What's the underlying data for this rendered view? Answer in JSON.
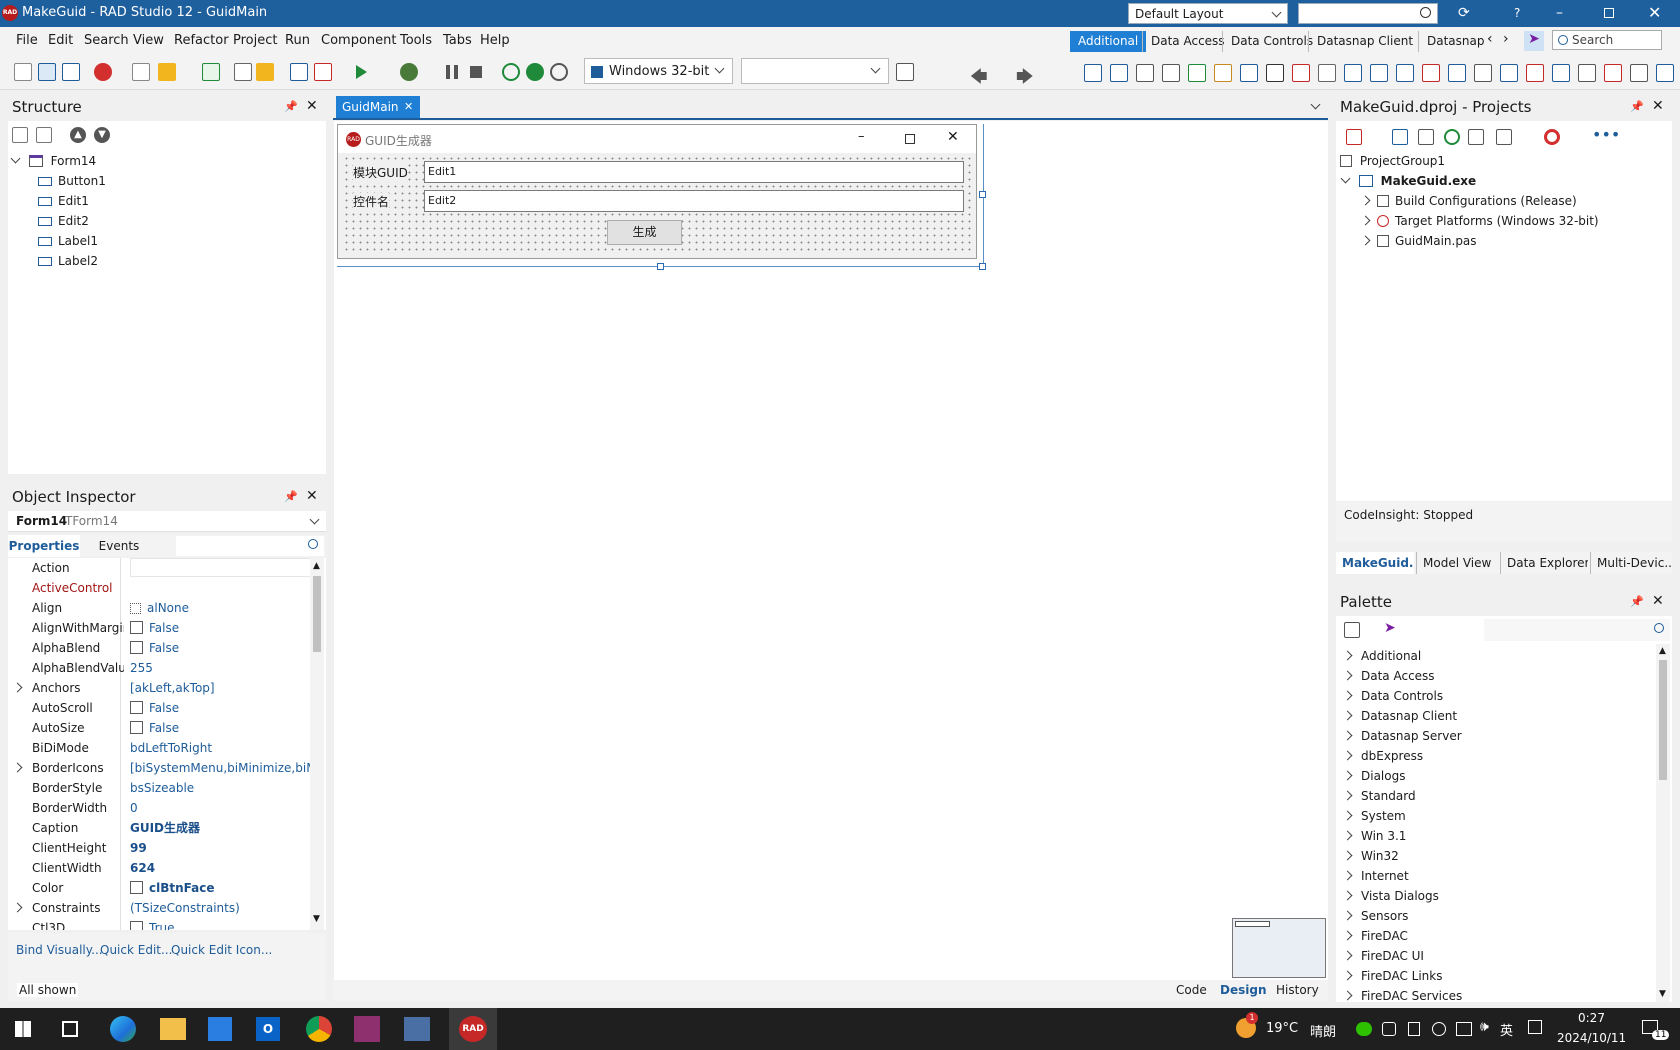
{
  "titlebar": {
    "app_badge": "RAD",
    "title": "MakeGuid - RAD Studio 12 - GuidMain",
    "layout_combo": "Default Layout",
    "help": "?"
  },
  "menu": [
    "File",
    "Edit",
    "Search",
    "View",
    "Refactor",
    "Project",
    "Run",
    "Component",
    "Tools",
    "Tabs",
    "Help"
  ],
  "palette_tabs": [
    "Additional",
    "Data Access",
    "Data Controls",
    "Datasnap Client",
    "Datasnap Se"
  ],
  "search_placeholder": "Search",
  "platform_combo": "Windows 32-bit",
  "structure": {
    "title": "Structure",
    "root": "Form14",
    "items": [
      "Button1",
      "Edit1",
      "Edit2",
      "Label1",
      "Label2"
    ]
  },
  "editor": {
    "tab": "GuidMain",
    "form_caption": "GUID生成器",
    "label1": "模块GUID",
    "edit1": "Edit1",
    "label2": "控件名",
    "edit2": "Edit2",
    "button": "生成",
    "bottom_tabs": [
      "Code",
      "Design",
      "History"
    ]
  },
  "inspector": {
    "title": "Object Inspector",
    "object_name": "Form14",
    "object_type": "TForm14",
    "tabs": [
      "Properties",
      "Events"
    ],
    "rows": [
      {
        "name": "Action",
        "value": "",
        "expand": false,
        "check": false,
        "bold": false,
        "red": false
      },
      {
        "name": "ActiveControl",
        "value": "",
        "expand": false,
        "check": false,
        "bold": false,
        "red": true
      },
      {
        "name": "Align",
        "value": "alNone",
        "expand": false,
        "check": false,
        "bold": false,
        "red": false,
        "icon": true
      },
      {
        "name": "AlignWithMargins",
        "value": "False",
        "expand": false,
        "check": true,
        "bold": false,
        "red": false
      },
      {
        "name": "AlphaBlend",
        "value": "False",
        "expand": false,
        "check": true,
        "bold": false,
        "red": false
      },
      {
        "name": "AlphaBlendValue",
        "value": "255",
        "expand": false,
        "check": false,
        "bold": false,
        "red": false
      },
      {
        "name": "Anchors",
        "value": "[akLeft,akTop]",
        "expand": true,
        "check": false,
        "bold": false,
        "red": false
      },
      {
        "name": "AutoScroll",
        "value": "False",
        "expand": false,
        "check": true,
        "bold": false,
        "red": false
      },
      {
        "name": "AutoSize",
        "value": "False",
        "expand": false,
        "check": true,
        "bold": false,
        "red": false
      },
      {
        "name": "BiDiMode",
        "value": "bdLeftToRight",
        "expand": false,
        "check": false,
        "bold": false,
        "red": false
      },
      {
        "name": "BorderIcons",
        "value": "[biSystemMenu,biMinimize,biMax",
        "expand": true,
        "check": false,
        "bold": false,
        "red": false
      },
      {
        "name": "BorderStyle",
        "value": "bsSizeable",
        "expand": false,
        "check": false,
        "bold": false,
        "red": false
      },
      {
        "name": "BorderWidth",
        "value": "0",
        "expand": false,
        "check": false,
        "bold": false,
        "red": false
      },
      {
        "name": "Caption",
        "value": "GUID生成器",
        "expand": false,
        "check": false,
        "bold": true,
        "red": false
      },
      {
        "name": "ClientHeight",
        "value": "99",
        "expand": false,
        "check": false,
        "bold": true,
        "red": false
      },
      {
        "name": "ClientWidth",
        "value": "624",
        "expand": false,
        "check": false,
        "bold": true,
        "red": false
      },
      {
        "name": "Color",
        "value": "clBtnFace",
        "expand": false,
        "check": true,
        "bold": true,
        "red": false
      },
      {
        "name": "Constraints",
        "value": "(TSizeConstraints)",
        "expand": true,
        "check": false,
        "bold": false,
        "red": false
      },
      {
        "name": "Ctl3D",
        "value": "True",
        "expand": false,
        "check": true,
        "bold": false,
        "red": false
      }
    ],
    "links": [
      "Bind Visually...",
      "Quick Edit...",
      "Quick Edit Icon..."
    ],
    "status": "All shown"
  },
  "projects": {
    "title": "MakeGuid.dproj - Projects",
    "group": "ProjectGroup1",
    "exe": "MakeGuid.exe",
    "children": [
      "Build Configurations (Release)",
      "Target Platforms (Windows 32-bit)",
      "GuidMain.pas"
    ],
    "codeinsight": "CodeInsight: Stopped",
    "tabs": [
      "MakeGuid....",
      "Model View",
      "Data Explorer",
      "Multi-Devic..."
    ]
  },
  "palette": {
    "title": "Palette",
    "categories": [
      "Additional",
      "Data Access",
      "Data Controls",
      "Datasnap Client",
      "Datasnap Server",
      "dbExpress",
      "Dialogs",
      "Standard",
      "System",
      "Win 3.1",
      "Win32",
      "Internet",
      "Vista Dialogs",
      "Sensors",
      "FireDAC",
      "FireDAC UI",
      "FireDAC Links",
      "FireDAC Services"
    ]
  },
  "taskbar": {
    "weather_temp": "19°C",
    "weather_text": "晴朗",
    "ime": "英",
    "time": "0:27",
    "date": "2024/10/11",
    "badge": "1",
    "notif_count": "11",
    "rad_label": "RAD"
  }
}
